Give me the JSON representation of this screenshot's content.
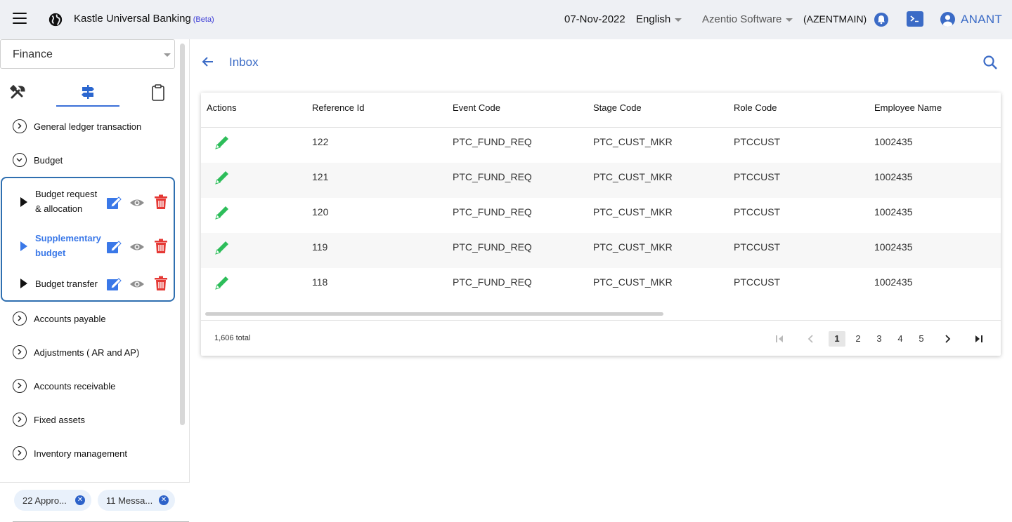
{
  "header": {
    "app_title": "Kastle Universal Banking",
    "beta_tag": "(Beta)",
    "date": "07-Nov-2022",
    "language": "English",
    "company": "Azentio Software",
    "entity_code": "(AZENTMAIN)",
    "user_name": "ANANT",
    "brand_color": "#3b6bc6"
  },
  "sidebar": {
    "module": "Finance",
    "tabs": [
      "tools-icon",
      "signpost-icon",
      "clipboard-icon"
    ],
    "menu": [
      {
        "label": "General ledger transaction"
      },
      {
        "label": "Budget"
      },
      {
        "label": "Accounts payable"
      },
      {
        "label": "Adjustments ( AR and AP)"
      },
      {
        "label": "Accounts receivable"
      },
      {
        "label": "Fixed assets"
      },
      {
        "label": "Inventory management"
      }
    ],
    "budget_sub": [
      {
        "label": "Budget request & allocation",
        "active": false
      },
      {
        "label": "Supplementary budget",
        "active": true
      },
      {
        "label": "Budget transfer",
        "active": false
      }
    ],
    "chips": [
      {
        "label": "22 Appro..."
      },
      {
        "label": "11 Messa..."
      }
    ]
  },
  "main": {
    "title": "Inbox",
    "columns": [
      "Actions",
      "Reference Id",
      "Event Code",
      "Stage Code",
      "Role Code",
      "Employee Name"
    ],
    "rows": [
      {
        "ref": "122",
        "event": "PTC_FUND_REQ",
        "stage": "PTC_CUST_MKR",
        "role": "PTCCUST",
        "employee": "1002435"
      },
      {
        "ref": "121",
        "event": "PTC_FUND_REQ",
        "stage": "PTC_CUST_MKR",
        "role": "PTCCUST",
        "employee": "1002435"
      },
      {
        "ref": "120",
        "event": "PTC_FUND_REQ",
        "stage": "PTC_CUST_MKR",
        "role": "PTCCUST",
        "employee": "1002435"
      },
      {
        "ref": "119",
        "event": "PTC_FUND_REQ",
        "stage": "PTC_CUST_MKR",
        "role": "PTCCUST",
        "employee": "1002435"
      },
      {
        "ref": "118",
        "event": "PTC_FUND_REQ",
        "stage": "PTC_CUST_MKR",
        "role": "PTCCUST",
        "employee": "1002435"
      }
    ],
    "total": "1,606 total",
    "pages": [
      "1",
      "2",
      "3",
      "4",
      "5"
    ],
    "current_page": "1"
  }
}
